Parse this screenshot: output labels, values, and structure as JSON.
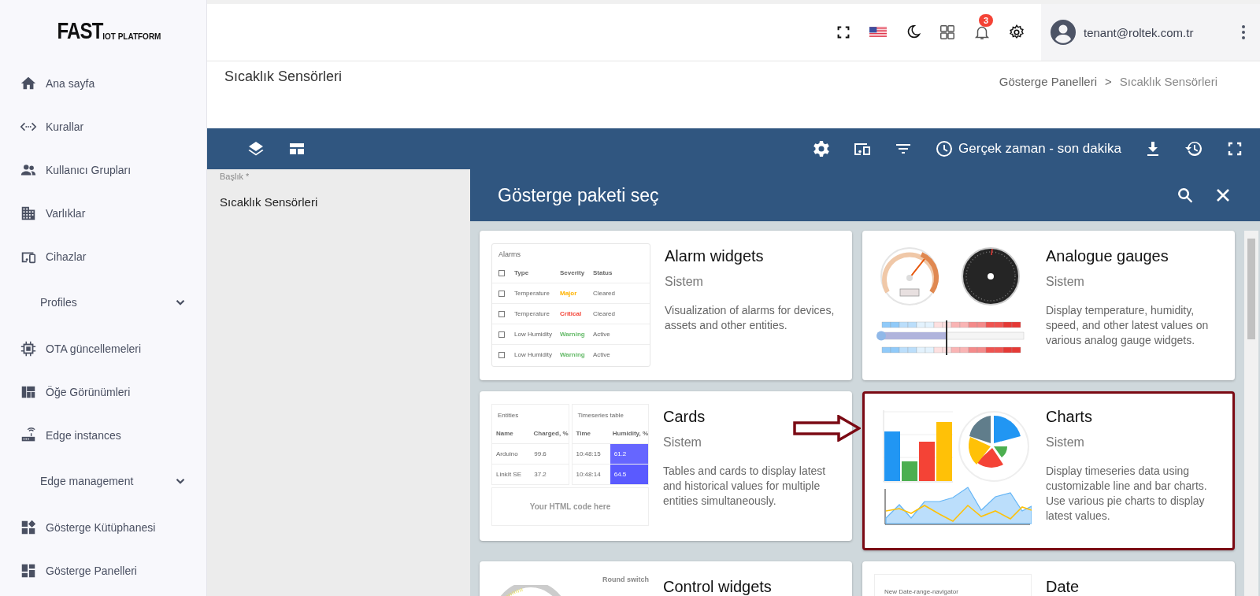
{
  "logo": {
    "main": "FAST",
    "sub": "IOT PLATFORM"
  },
  "sidebar": {
    "items": [
      {
        "label": "Ana sayfa",
        "kind": "link"
      },
      {
        "label": "Kurallar",
        "kind": "link"
      },
      {
        "label": "Kullanıcı Grupları",
        "kind": "link"
      },
      {
        "label": "Varlıklar",
        "kind": "link"
      },
      {
        "label": "Cihazlar",
        "kind": "link"
      },
      {
        "label": "Profiles",
        "kind": "group",
        "expanded": false
      },
      {
        "label": "OTA güncellemeleri",
        "kind": "link"
      },
      {
        "label": "Öğe Görünümleri",
        "kind": "link"
      },
      {
        "label": "Edge instances",
        "kind": "link"
      },
      {
        "label": "Edge management",
        "kind": "group",
        "expanded": false
      },
      {
        "label": "Gösterge Kütüphanesi",
        "kind": "link"
      },
      {
        "label": "Gösterge Panelleri",
        "kind": "link"
      }
    ]
  },
  "header": {
    "notifications": "3",
    "user": "tenant@roltek.com.tr"
  },
  "page": {
    "title": "Sıcaklık Sensörleri",
    "breadcrumb": [
      "Gösterge Panelleri",
      "Sıcaklık Sensörleri"
    ],
    "breadcrumb_separator": ">"
  },
  "toolbar": {
    "time_window": "Gerçek zaman - son dakika"
  },
  "form": {
    "label": "Başlık *",
    "value": "Sıcaklık Sensörleri"
  },
  "panel": {
    "title": "Gösterge paketi seç",
    "bundles": [
      {
        "title": "Alarm widgets",
        "subtitle": "Sistem",
        "description": "Visualization of alarms for devices, assets and other entities.",
        "highlighted": false,
        "preview": {
          "kind": "alarms",
          "title": "Alarms",
          "columns": [
            "Type",
            "Severity",
            "Status"
          ],
          "rows": [
            {
              "checked": false,
              "type": "Temperature",
              "severity": "Major",
              "color": "#ffb300",
              "status": "Cleared"
            },
            {
              "checked": false,
              "type": "Temperature",
              "severity": "Critical",
              "color": "#f44336",
              "status": "Cleared"
            },
            {
              "checked": false,
              "type": "Low Humidity",
              "severity": "Warning",
              "color": "#66bb6a",
              "status": "Active"
            },
            {
              "checked": false,
              "type": "Low Humidity",
              "severity": "Warning",
              "color": "#66bb6a",
              "status": "Active"
            }
          ]
        }
      },
      {
        "title": "Analogue gauges",
        "subtitle": "Sistem",
        "description": "Display temperature, humidity, speed, and other latest values on various analog gauge widgets.",
        "highlighted": false,
        "preview": {
          "kind": "gauges"
        }
      },
      {
        "title": "Cards",
        "subtitle": "Sistem",
        "description": "Tables and cards to display latest and historical values for multiple entities simultaneously.",
        "highlighted": false,
        "preview": {
          "kind": "cards",
          "tables": [
            {
              "title": "Entities",
              "columns": [
                "Name",
                "Charged, %"
              ],
              "rows": [
                {
                  "cells": [
                    "Arduino",
                    "99.6"
                  ]
                },
                {
                  "cells": [
                    "LinkIt SE",
                    "37.2"
                  ]
                }
              ]
            },
            {
              "title": "Timeseries table",
              "columns": [
                "Time",
                "Humidity, %"
              ],
              "rows": [
                {
                  "cells": [
                    "10:48:15",
                    "61.2"
                  ],
                  "color": "#6666ff"
                },
                {
                  "cells": [
                    "10:48:14",
                    "64.5"
                  ],
                  "color": "#5a5aff"
                }
              ]
            }
          ],
          "html": "Your HTML code here"
        }
      },
      {
        "title": "Charts",
        "subtitle": "Sistem",
        "description": "Display timeseries data using customizable line and bar charts. Use various pie charts to display latest values.",
        "highlighted": true,
        "preview": {
          "kind": "charts"
        }
      },
      {
        "title": "Control widgets",
        "highlighted": false,
        "preview": {
          "kind": "control",
          "label": "Round switch"
        }
      },
      {
        "title": "Date",
        "highlighted": false,
        "preview": {
          "kind": "date",
          "label": "New Date-range-navigator"
        }
      }
    ]
  }
}
